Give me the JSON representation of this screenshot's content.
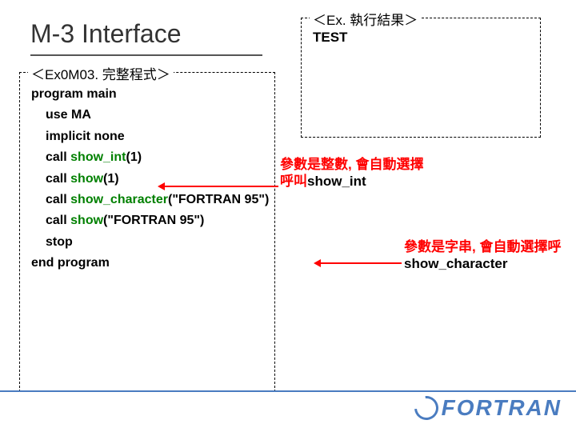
{
  "title": "M-3 Interface",
  "result": {
    "label": "＜Ex. 執行結果＞",
    "content": "TEST"
  },
  "code": {
    "label": "＜Ex0M03. 完整程式＞",
    "lines": {
      "l1": "program main",
      "l2": "use MA",
      "l3": "implicit none",
      "l4_a": "call ",
      "l4_b": "show_int",
      "l4_c": "(1)",
      "l5_a": "call ",
      "l5_b": "show",
      "l5_c": "(1)",
      "l6_a": "call ",
      "l6_b": "show_character",
      "l6_c": "(\"FORTRAN 95\")",
      "l7_a": "call ",
      "l7_b": "show",
      "l7_c": "(\"FORTRAN 95\")",
      "l8": "stop",
      "l9": "end program"
    }
  },
  "notes": {
    "n1_a": "參數是整數, 會自動選擇呼叫",
    "n1_b": "show_int",
    "n2_a": "參數是字串, 會自動選擇呼",
    "n2_b": "show_character"
  },
  "logo": "FORTRAN"
}
